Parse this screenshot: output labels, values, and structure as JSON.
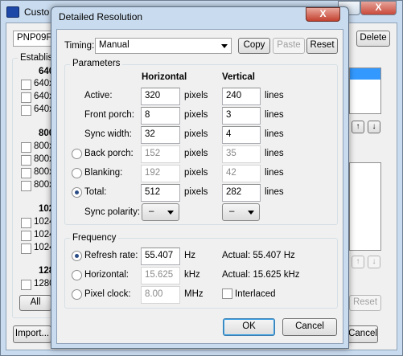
{
  "parent_window": {
    "title": "Custo",
    "profile_value": "PNP09FF",
    "delete_label": "Delete",
    "established_label": "Establis",
    "groups": [
      {
        "header": "640",
        "items": [
          "640x",
          "640x",
          "640x"
        ]
      },
      {
        "header": "800",
        "items": [
          "800x",
          "800x",
          "800x",
          "800x"
        ]
      },
      {
        "header": "102",
        "items": [
          "1024",
          "1024",
          "1024"
        ]
      },
      {
        "header": "128",
        "items": [
          "1280"
        ]
      }
    ],
    "all_label": "All",
    "import_label": "Import...",
    "cancel_label": "Cancel",
    "reset_label": "Reset",
    "up_arrow": "↑",
    "down_arrow": "↓",
    "close_glyph": "X"
  },
  "dialog": {
    "title": "Detailed Resolution",
    "close_glyph": "X",
    "timing": {
      "label": "Timing:",
      "value": "Manual"
    },
    "toolbar": {
      "copy": "Copy",
      "paste": "Paste",
      "reset": "Reset"
    },
    "parameters": {
      "title": "Parameters",
      "col_horizontal": "Horizontal",
      "col_vertical": "Vertical",
      "rows": [
        {
          "label": "Active:",
          "h": "320",
          "h_unit": "pixels",
          "v": "240",
          "v_unit": "lines"
        },
        {
          "label": "Front porch:",
          "h": "8",
          "h_unit": "pixels",
          "v": "3",
          "v_unit": "lines"
        },
        {
          "label": "Sync width:",
          "h": "32",
          "h_unit": "pixels",
          "v": "4",
          "v_unit": "lines"
        },
        {
          "label": "Back porch:",
          "h": "152",
          "h_unit": "pixels",
          "v": "35",
          "v_unit": "lines"
        },
        {
          "label": "Blanking:",
          "h": "192",
          "h_unit": "pixels",
          "v": "42",
          "v_unit": "lines"
        },
        {
          "label": "Total:",
          "h": "512",
          "h_unit": "pixels",
          "v": "282",
          "v_unit": "lines"
        }
      ],
      "sync_polarity_label": "Sync polarity:",
      "sync_h": "–",
      "sync_v": "–"
    },
    "frequency": {
      "title": "Frequency",
      "refresh_label": "Refresh rate:",
      "refresh_value": "55.407",
      "refresh_unit": "Hz",
      "refresh_actual": "Actual: 55.407 Hz",
      "horizontal_label": "Horizontal:",
      "horizontal_value": "15.625",
      "horizontal_unit": "kHz",
      "horizontal_actual": "Actual: 15.625 kHz",
      "pixel_clock_label": "Pixel clock:",
      "pixel_clock_value": "8.00",
      "pixel_clock_unit": "MHz",
      "interlaced_label": "Interlaced"
    },
    "ok_label": "OK",
    "cancel_label": "Cancel"
  }
}
